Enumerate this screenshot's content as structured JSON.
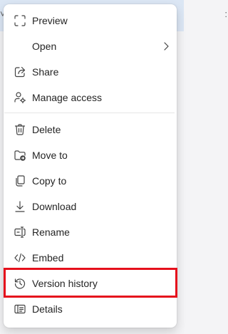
{
  "menu": {
    "items": [
      {
        "label": "Preview",
        "icon": "preview-icon"
      },
      {
        "label": "Open",
        "icon": "",
        "has_submenu": true
      },
      {
        "label": "Share",
        "icon": "share-icon"
      },
      {
        "label": "Manage access",
        "icon": "manage-access-icon"
      },
      {
        "label": "Delete",
        "icon": "delete-icon"
      },
      {
        "label": "Move to",
        "icon": "move-to-icon"
      },
      {
        "label": "Copy to",
        "icon": "copy-to-icon"
      },
      {
        "label": "Download",
        "icon": "download-icon"
      },
      {
        "label": "Rename",
        "icon": "rename-icon"
      },
      {
        "label": "Embed",
        "icon": "embed-icon"
      },
      {
        "label": "Version history",
        "icon": "version-history-icon",
        "highlighted": true
      },
      {
        "label": "Details",
        "icon": "details-icon"
      }
    ]
  },
  "colors": {
    "highlight_border": "#e5101c",
    "menu_background": "#ffffff",
    "text": "#242424"
  }
}
